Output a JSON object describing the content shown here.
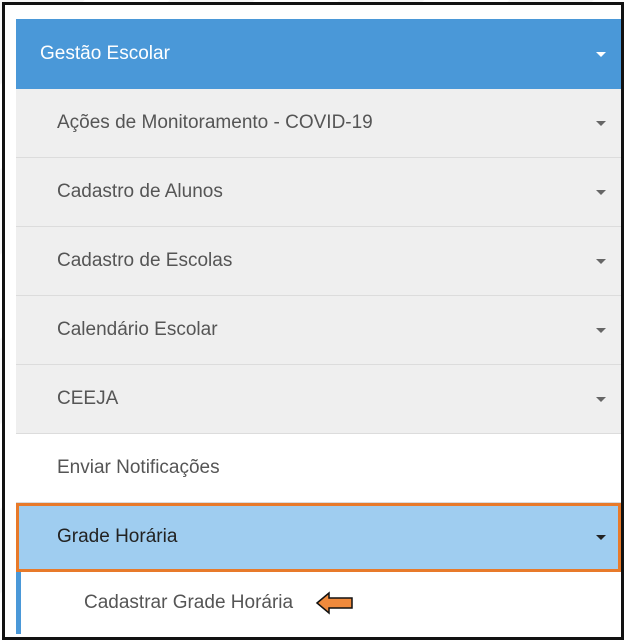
{
  "menu": {
    "header_label": "Gestão Escolar",
    "items": [
      {
        "label": "Ações de Monitoramento - COVID-19",
        "has_caret": true
      },
      {
        "label": "Cadastro de Alunos",
        "has_caret": true
      },
      {
        "label": "Cadastro de Escolas",
        "has_caret": true
      },
      {
        "label": "Calendário Escolar",
        "has_caret": true
      },
      {
        "label": "CEEJA",
        "has_caret": true
      },
      {
        "label": "Enviar Notificações",
        "has_caret": false
      },
      {
        "label": "Grade Horária",
        "has_caret": true,
        "active": true
      }
    ],
    "submenu": {
      "label": "Cadastrar Grade Horária",
      "annotation_icon": "left-arrow-icon"
    }
  },
  "colors": {
    "header_bg": "#4a98d8",
    "item_bg": "#efefef",
    "active_bg": "#9fcdf0",
    "highlight_outline": "#e87a2a",
    "arrow_fill": "#f08a3c"
  }
}
